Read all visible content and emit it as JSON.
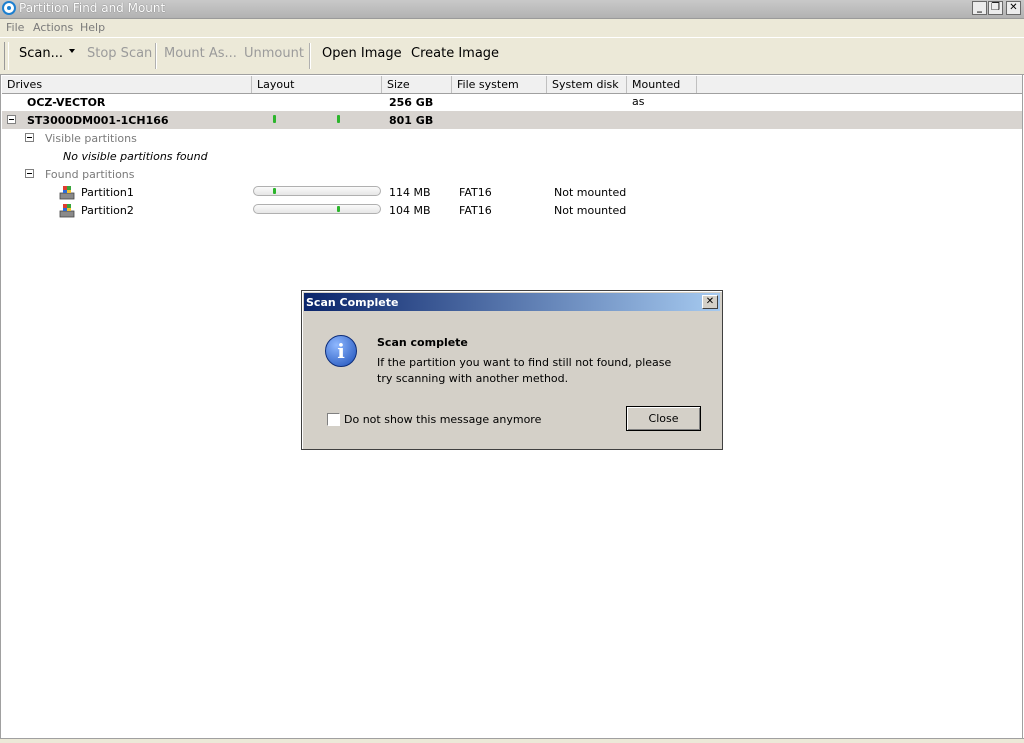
{
  "window": {
    "title": "Partition Find and Mount",
    "min_glyph": "_",
    "restore_glyph": "❐",
    "close_glyph": "✕"
  },
  "menu": {
    "file": "File",
    "actions": "Actions",
    "help": "Help"
  },
  "toolbar": {
    "scan": "Scan...",
    "stop_scan": "Stop Scan",
    "mount_as": "Mount As...",
    "unmount": "Unmount",
    "open_image": "Open Image",
    "create_image": "Create Image"
  },
  "columns": {
    "drives": "Drives",
    "layout": "Layout",
    "size": "Size",
    "file_system": "File system",
    "system_disk": "System disk",
    "mounted_as": "Mounted as"
  },
  "rows": {
    "drive1": {
      "name": "OCZ-VECTOR",
      "size": "256 GB"
    },
    "drive2": {
      "name": "ST3000DM001-1CH166",
      "size": "801 GB"
    },
    "visible_group": "Visible partitions",
    "no_visible": "No visible partitions found",
    "found_group": "Found partitions",
    "part1": {
      "name": "Partition1",
      "size": "114 MB",
      "fs": "FAT16",
      "status": "Not mounted"
    },
    "part2": {
      "name": "Partition2",
      "size": "104 MB",
      "fs": "FAT16",
      "status": "Not mounted"
    }
  },
  "dialog": {
    "title": "Scan Complete",
    "close_glyph": "✕",
    "info_glyph": "i",
    "heading": "Scan complete",
    "message": "If the partition you want to find still not found, please try scanning with another method.",
    "checkbox_label": "Do not show this message anymore",
    "close_button": "Close"
  },
  "colors": {
    "layout_mark": "#2cb52c",
    "dialog_title_start": "#0a246a",
    "dialog_title_end": "#a6caf0"
  }
}
